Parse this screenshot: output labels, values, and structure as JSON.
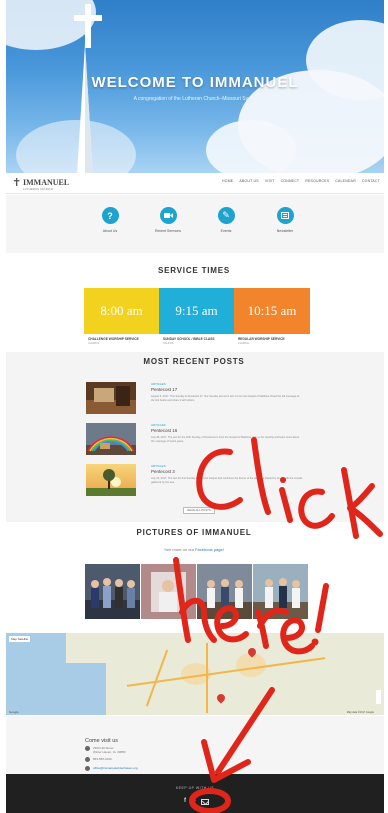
{
  "hero": {
    "title": "WELCOME TO IMMANUEL",
    "subtitle": "A congregation of the Lutheran Church–Missouri Synod"
  },
  "nav": {
    "logo_text": "IMMANUEL",
    "logo_sub": "LUTHERAN CHURCH",
    "menu": [
      "HOME",
      "ABOUT US",
      "VISIT",
      "CONNECT",
      "RESOURCES",
      "CALENDAR",
      "CONTACT"
    ]
  },
  "quick_links": [
    {
      "label": "About Us",
      "icon": "question-icon"
    },
    {
      "label": "Recent Sermons",
      "icon": "video-camera-icon"
    },
    {
      "label": "Events",
      "icon": "pencil-icon"
    },
    {
      "label": "Newsletter",
      "icon": "newsletter-icon"
    }
  ],
  "service_times": {
    "title": "SERVICE TIMES",
    "items": [
      {
        "time": "8:00 am",
        "name": "CHALLENGE WORSHIP SERVICE",
        "place": "CHURCH",
        "color": "#f2d21e"
      },
      {
        "time": "9:15 am",
        "name": "SUNDAY SCHOOL / BIBLE CLASS",
        "place": "SCHOOL",
        "color": "#20afd9"
      },
      {
        "time": "10:15 am",
        "name": "REGULAR WORSHIP SERVICE",
        "place": "CHURCH",
        "color": "#f2852c"
      }
    ]
  },
  "posts": {
    "title": "MOST RECENT POSTS",
    "read_more": "READ ALL POSTS",
    "items": [
      {
        "tag": "ARTICLES",
        "title": "Pentecost 17",
        "body": "August 5, 2017. This Sunday is Pentecost 17. Our Sunday sermon's text is from the Gospel of Matthew. Read the full message at the link below and share it with others."
      },
      {
        "tag": "ARTICLES",
        "title": "Pentecost 16",
        "body": "July 28, 2017. The text for the 16th Sunday of Pentecost is from the Gospel of Matthew. Join us for worship and learn more about the message of God's grace."
      },
      {
        "tag": "ARTICLES",
        "title": "Pentecost 3",
        "body": "July 20, 2017. The text for this Sunday is from the Gospel and continues the theme of the parables shared by Jesus with the crowds gathered by the sea."
      }
    ]
  },
  "pictures": {
    "title": "PICTURES OF IMMANUEL",
    "note_prefix": "See more on our",
    "note_link": "Facebook page!"
  },
  "map": {
    "control": "Map  Satellite",
    "google": "Google",
    "credit": "Map data ©2017 Google"
  },
  "contact": {
    "title": "Come visit us",
    "address_line1": "2300 Hill Street",
    "address_line2": "Winter Haven, FL 33880",
    "phone": "863-555-0100",
    "email": "office@immanuelwinterhaven.org"
  },
  "footer": {
    "label": "KEEP UP WITH US"
  },
  "annotation": {
    "text": "Click here!",
    "color": "#e0261a"
  }
}
